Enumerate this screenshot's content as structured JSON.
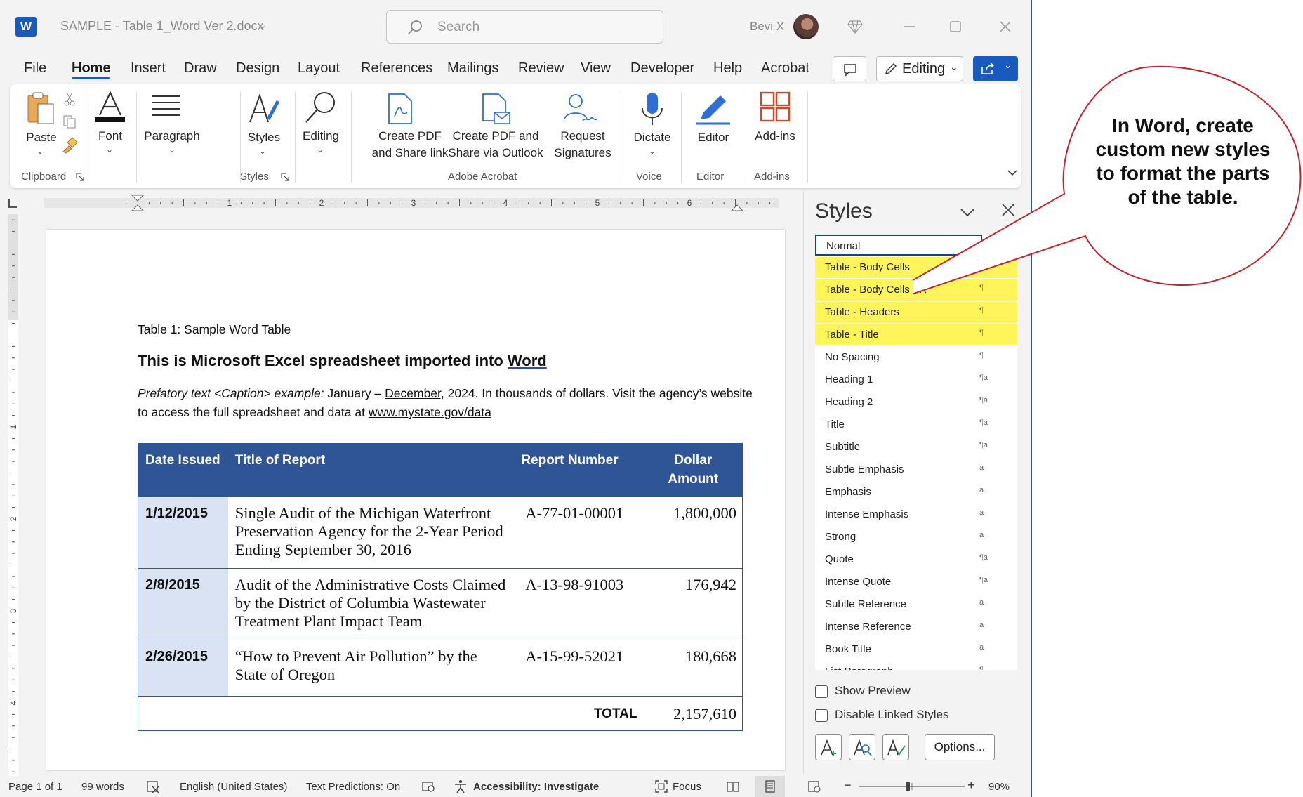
{
  "window": {
    "doc_title": "SAMPLE - Table 1_Word Ver 2.docx",
    "search_placeholder": "Search",
    "user_name": "Bevi X"
  },
  "menu": {
    "tabs": [
      "File",
      "Home",
      "Insert",
      "Draw",
      "Design",
      "Layout",
      "References",
      "Mailings",
      "Review",
      "View",
      "Developer",
      "Help",
      "Acrobat"
    ],
    "active_tab": "Home",
    "editing_label": "Editing"
  },
  "ribbon": {
    "paste": "Paste",
    "font": "Font",
    "paragraph": "Paragraph",
    "styles": "Styles",
    "editing": "Editing",
    "create_pdf_1": "Create PDF",
    "create_pdf_2": "and Share link",
    "create_pdf_outlook_1": "Create PDF and",
    "create_pdf_outlook_2": "Share via Outlook",
    "request_sig_1": "Request",
    "request_sig_2": "Signatures",
    "dictate": "Dictate",
    "editor": "Editor",
    "addins": "Add-ins",
    "group_clipboard": "Clipboard",
    "group_styles": "Styles",
    "group_adobe": "Adobe Acrobat",
    "group_voice": "Voice",
    "group_editor": "Editor",
    "group_addins": "Add-ins"
  },
  "ruler": {
    "numbers": [
      "1",
      "2",
      "3",
      "4",
      "5",
      "6"
    ],
    "vnumbers": [
      "1",
      "2",
      "3",
      "4"
    ]
  },
  "document": {
    "caption": "Table 1: Sample Word Table",
    "heading_pre": "This is Microsoft Excel spreadsheet imported into ",
    "heading_word": "Word",
    "prefatory_italic": "Prefatory text <Caption> example:",
    "prefatory_a": "  January – ",
    "prefatory_dec": "December,",
    "prefatory_b": " 2024. In thousands of dollars. Visit the agency’s website to access the full spreadsheet and data at ",
    "prefatory_url": "www.mystate.gov/data",
    "table": {
      "headers": [
        "Date Issued",
        "Title of Report",
        "Report Number",
        "Dollar Amount"
      ],
      "rows": [
        [
          "1/12/2015",
          "Single Audit of the Michigan Waterfront Preservation Agency for the 2-Year Period Ending September 30, 2016",
          "A-77-01-00001",
          "1,800,000"
        ],
        [
          "2/8/2015",
          "Audit of the Administrative Costs Claimed by the District of Columbia Wastewater Treatment Plant Impact Team",
          "A-13-98-91003",
          "176,942"
        ],
        [
          "2/26/2015",
          "“How to Prevent Air Pollution” by the State of Oregon",
          "A-15-99-52021",
          "180,668"
        ]
      ],
      "total_label": "TOTAL",
      "total_value": "2,157,610"
    }
  },
  "styles_pane": {
    "title": "Styles",
    "items": [
      {
        "name": "Normal",
        "mark": "¶"
      },
      {
        "name": "Table - Body Cells",
        "mark": "¶"
      },
      {
        "name": "Table - Body Cells FR",
        "mark": "¶"
      },
      {
        "name": "Table - Headers",
        "mark": "¶"
      },
      {
        "name": "Table - Title",
        "mark": "¶"
      },
      {
        "name": "No Spacing",
        "mark": "¶"
      },
      {
        "name": "Heading 1",
        "mark": "¶a"
      },
      {
        "name": "Heading 2",
        "mark": "¶a"
      },
      {
        "name": "Title",
        "mark": "¶a"
      },
      {
        "name": "Subtitle",
        "mark": "¶a"
      },
      {
        "name": "Subtle Emphasis",
        "mark": "a"
      },
      {
        "name": "Emphasis",
        "mark": "a"
      },
      {
        "name": "Intense Emphasis",
        "mark": "a"
      },
      {
        "name": "Strong",
        "mark": "a"
      },
      {
        "name": "Quote",
        "mark": "¶a"
      },
      {
        "name": "Intense Quote",
        "mark": "¶a"
      },
      {
        "name": "Subtle Reference",
        "mark": "a"
      },
      {
        "name": "Intense Reference",
        "mark": "a"
      },
      {
        "name": "Book Title",
        "mark": "a"
      },
      {
        "name": "List Paragraph",
        "mark": "¶"
      }
    ],
    "highlight_color": "#fff45a",
    "show_preview": "Show Preview",
    "disable_linked": "Disable Linked Styles",
    "options": "Options..."
  },
  "statusbar": {
    "page": "Page 1 of 1",
    "words": "99 words",
    "language": "English (United States)",
    "text_predictions": "Text Predictions: On",
    "accessibility": "Accessibility: Investigate",
    "focus": "Focus",
    "zoom": "90%"
  },
  "callout": {
    "text": "In Word, create custom new styles to format the parts of the table."
  },
  "colors": {
    "accent": "#185abd",
    "table_header": "#2f5597",
    "date_cell": "#dae3f3",
    "callout_border": "#c0242c"
  }
}
